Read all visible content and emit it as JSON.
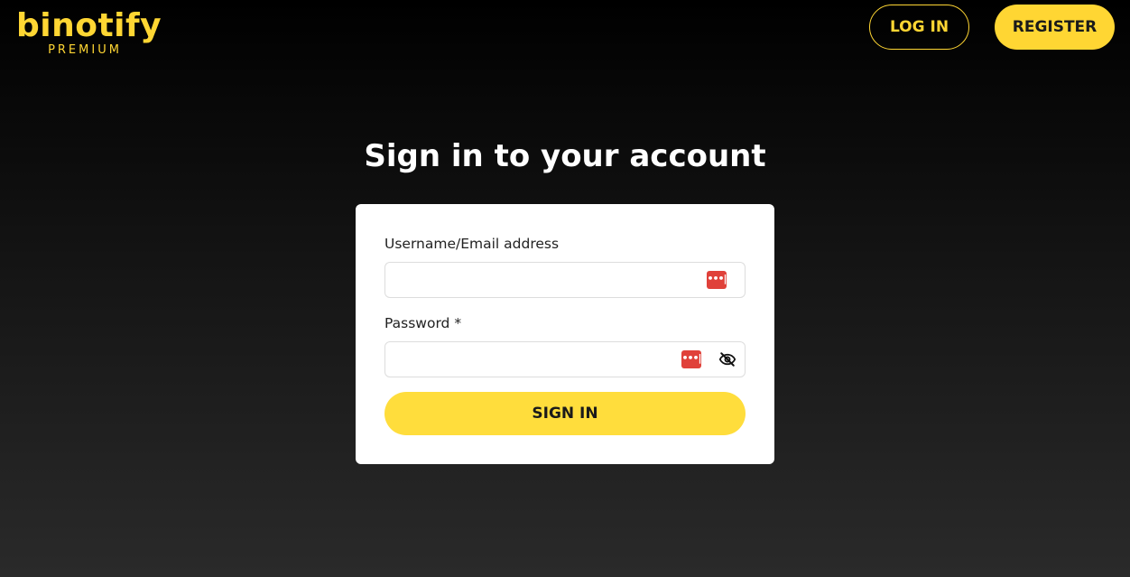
{
  "brand": {
    "name": "binotify",
    "tagline": "PREMIUM"
  },
  "nav": {
    "login_label": "LOG IN",
    "register_label": "REGISTER"
  },
  "main": {
    "title": "Sign in to your account"
  },
  "form": {
    "username_label": "Username/Email address",
    "username_value": "",
    "password_label": "Password *",
    "password_value": "",
    "submit_label": "SIGN IN"
  },
  "icons": {
    "password_manager": "password-manager-icon",
    "toggle_visibility": "eye-off-icon"
  },
  "colors": {
    "accent": "#ffd633",
    "button": "#ffdd3c",
    "password_manager": "#e0413a"
  }
}
